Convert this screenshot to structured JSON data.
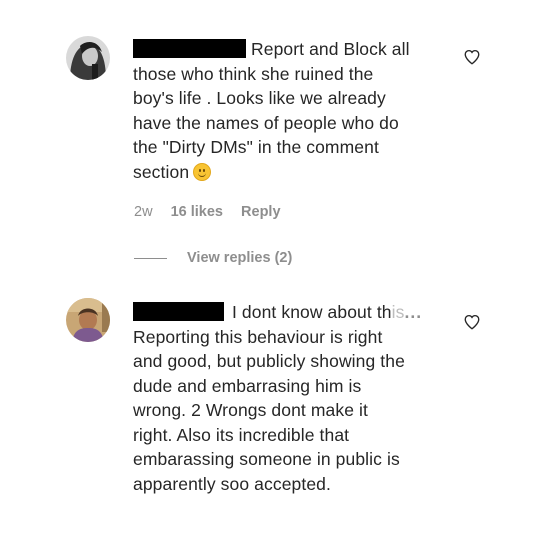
{
  "comments": [
    {
      "text_lines": [
        "Report and Block all",
        "those who think she ruined the",
        "boy's life . Looks like we already",
        "have the names of people who do",
        "the \"Dirty DMs\" in the comment",
        "section"
      ],
      "time": "2w",
      "likes": "16 likes",
      "reply_label": "Reply",
      "view_replies": "View replies (2)"
    },
    {
      "first_visible": "I dont know about th",
      "first_faded": "is",
      "more": "...",
      "text_lines": [
        "Reporting this behaviour is right",
        "and good, but publicly showing the",
        "dude and embarrasing him is",
        "wrong. 2 Wrongs dont make it",
        "right. Also its incredible that",
        "embarassing someone in public is",
        "apparently soo accepted."
      ]
    }
  ],
  "icons": {
    "like": "heart-outline-icon",
    "emoji": "smiling-face-emoji"
  },
  "colors": {
    "text": "#262626",
    "secondary": "#8e8e8e",
    "redaction": "#000000"
  }
}
